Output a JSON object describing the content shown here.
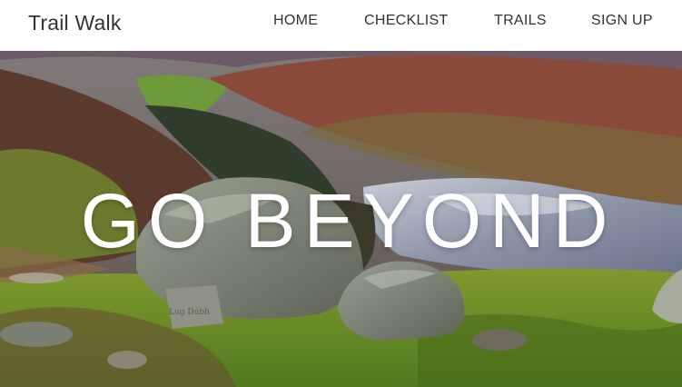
{
  "brand": {
    "title": "Trail Walk"
  },
  "nav": {
    "home": "HOME",
    "checklist": "CHECKLIST",
    "trails": "TRAILS",
    "signup": "SIGN UP"
  },
  "hero": {
    "title": "GO BEYOND",
    "stone_inscription": "Lug Dúbh"
  }
}
